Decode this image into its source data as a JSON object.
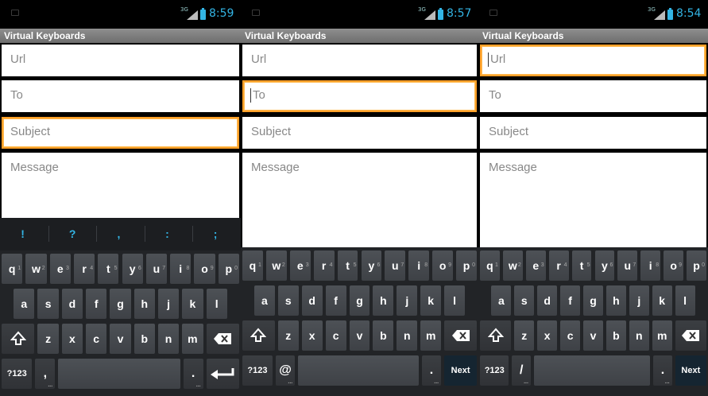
{
  "screens": [
    {
      "status": {
        "network": "3G",
        "time": "8:59"
      },
      "app_title": "Virtual Keyboards",
      "fields": {
        "url": "Url",
        "to": "To",
        "subject": "Subject",
        "message": "Message"
      },
      "focused_field": "subject",
      "suggestions": [
        "!",
        "?",
        ",",
        ":",
        ";"
      ],
      "keys": {
        "row1": [
          "q",
          "w",
          "e",
          "r",
          "t",
          "y",
          "u",
          "i",
          "o",
          "p"
        ],
        "row1_digits": [
          "1",
          "2",
          "3",
          "4",
          "5",
          "6",
          "7",
          "8",
          "9",
          "0"
        ],
        "row2": [
          "a",
          "s",
          "d",
          "f",
          "g",
          "h",
          "j",
          "k",
          "l"
        ],
        "row3": [
          "z",
          "x",
          "c",
          "v",
          "b",
          "n",
          "m"
        ],
        "symbols": "?123",
        "special": ",",
        "period": ".",
        "action": "enter"
      }
    },
    {
      "status": {
        "network": "3G",
        "time": "8:57"
      },
      "app_title": "Virtual Keyboards",
      "fields": {
        "url": "Url",
        "to": "To",
        "subject": "Subject",
        "message": "Message"
      },
      "focused_field": "to",
      "keys": {
        "row1": [
          "q",
          "w",
          "e",
          "r",
          "t",
          "y",
          "u",
          "i",
          "o",
          "p"
        ],
        "row1_digits": [
          "1",
          "2",
          "3",
          "4",
          "5",
          "6",
          "7",
          "8",
          "9",
          "0"
        ],
        "row2": [
          "a",
          "s",
          "d",
          "f",
          "g",
          "h",
          "j",
          "k",
          "l"
        ],
        "row3": [
          "z",
          "x",
          "c",
          "v",
          "b",
          "n",
          "m"
        ],
        "symbols": "?123",
        "special": "@",
        "period": ".",
        "action": "Next"
      }
    },
    {
      "status": {
        "network": "3G",
        "time": "8:54"
      },
      "app_title": "Virtual Keyboards",
      "fields": {
        "url": "Url",
        "to": "To",
        "subject": "Subject",
        "message": "Message"
      },
      "focused_field": "url",
      "keys": {
        "row1": [
          "q",
          "w",
          "e",
          "r",
          "t",
          "y",
          "u",
          "i",
          "o",
          "p"
        ],
        "row1_digits": [
          "1",
          "2",
          "3",
          "4",
          "5",
          "6",
          "7",
          "8",
          "9",
          "0"
        ],
        "row2": [
          "a",
          "s",
          "d",
          "f",
          "g",
          "h",
          "j",
          "k",
          "l"
        ],
        "row3": [
          "z",
          "x",
          "c",
          "v",
          "b",
          "n",
          "m"
        ],
        "symbols": "?123",
        "special": "/",
        "period": ".",
        "action": "Next"
      }
    }
  ],
  "colors": {
    "focus": "#ffa028",
    "accent": "#33b5e5",
    "key": "#45494e"
  }
}
